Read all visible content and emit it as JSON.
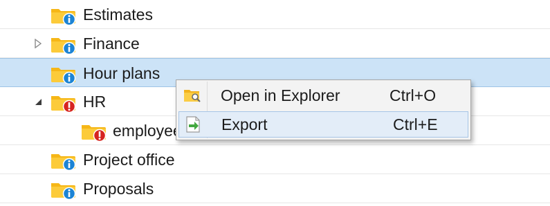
{
  "tree": {
    "items": [
      {
        "label": "Estimates",
        "badge": "info-badge-icon"
      },
      {
        "label": "Finance",
        "badge": "info-badge-icon",
        "expander": "collapsed"
      },
      {
        "label": "Hour plans",
        "badge": "info-badge-icon",
        "selected": true
      },
      {
        "label": "HR",
        "badge": "error-badge-icon",
        "expander": "expanded"
      },
      {
        "label": "employees",
        "badge": "error-badge-icon"
      },
      {
        "label": "Project office",
        "badge": "info-badge-icon"
      },
      {
        "label": "Proposals",
        "badge": "info-badge-icon"
      }
    ]
  },
  "context_menu": {
    "items": [
      {
        "label": "Open in Explorer",
        "shortcut": "Ctrl+O",
        "icon": "open-folder-icon"
      },
      {
        "label": "Export",
        "shortcut": "Ctrl+E",
        "icon": "export-icon",
        "highlighted": true
      }
    ]
  },
  "colors": {
    "selection_bg": "#cce3f7",
    "folder_yellow": "#f6b717",
    "info_blue": "#1d84d4",
    "error_red": "#d6251f",
    "menu_bg": "#f3f3f3",
    "menu_hover": "#e3edf8"
  }
}
